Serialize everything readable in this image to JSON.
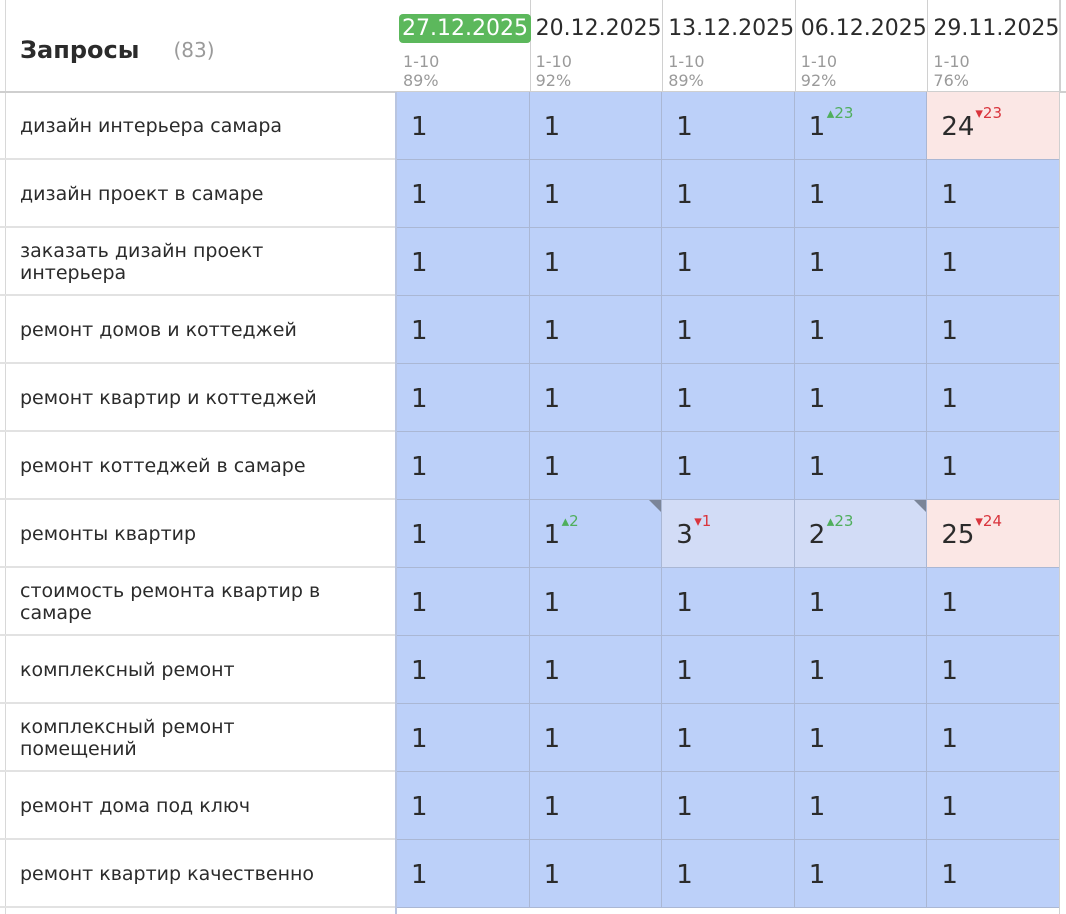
{
  "header": {
    "title": "Запросы",
    "count": "(83)"
  },
  "columns": [
    {
      "date": "27.12.2025",
      "range": "1-10",
      "percent": "89%",
      "active": true
    },
    {
      "date": "20.12.2025",
      "range": "1-10",
      "percent": "92%",
      "active": false
    },
    {
      "date": "13.12.2025",
      "range": "1-10",
      "percent": "89%",
      "active": false
    },
    {
      "date": "06.12.2025",
      "range": "1-10",
      "percent": "92%",
      "active": false
    },
    {
      "date": "29.11.2025",
      "range": "1-10",
      "percent": "76%",
      "active": false
    }
  ],
  "rows": [
    {
      "query": "дизайн интерьера самара",
      "cells": [
        {
          "v": "1"
        },
        {
          "v": "1"
        },
        {
          "v": "1"
        },
        {
          "v": "1",
          "delta": "▴23",
          "dir": "up"
        },
        {
          "v": "24",
          "delta": "▾23",
          "dir": "down",
          "style": "pink"
        }
      ]
    },
    {
      "query": "дизайн проект в самаре",
      "cells": [
        {
          "v": "1"
        },
        {
          "v": "1"
        },
        {
          "v": "1"
        },
        {
          "v": "1"
        },
        {
          "v": "1"
        }
      ]
    },
    {
      "query": "заказать дизайн проект интерьера",
      "cells": [
        {
          "v": "1"
        },
        {
          "v": "1"
        },
        {
          "v": "1"
        },
        {
          "v": "1"
        },
        {
          "v": "1"
        }
      ]
    },
    {
      "query": "ремонт домов и коттеджей",
      "cells": [
        {
          "v": "1"
        },
        {
          "v": "1"
        },
        {
          "v": "1"
        },
        {
          "v": "1"
        },
        {
          "v": "1"
        }
      ]
    },
    {
      "query": "ремонт квартир и коттеджей",
      "cells": [
        {
          "v": "1"
        },
        {
          "v": "1"
        },
        {
          "v": "1"
        },
        {
          "v": "1"
        },
        {
          "v": "1"
        }
      ]
    },
    {
      "query": "ремонт коттеджей в самаре",
      "cells": [
        {
          "v": "1"
        },
        {
          "v": "1"
        },
        {
          "v": "1"
        },
        {
          "v": "1"
        },
        {
          "v": "1"
        }
      ]
    },
    {
      "query": "ремонты квартир",
      "cells": [
        {
          "v": "1"
        },
        {
          "v": "1",
          "delta": "▴2",
          "dir": "up",
          "corner": true
        },
        {
          "v": "3",
          "delta": "▾1",
          "dir": "down",
          "style": "light"
        },
        {
          "v": "2",
          "delta": "▴23",
          "dir": "up",
          "style": "light",
          "corner": true
        },
        {
          "v": "25",
          "delta": "▾24",
          "dir": "down",
          "style": "pink"
        }
      ]
    },
    {
      "query": "стоимость ремонта квартир в самаре",
      "cells": [
        {
          "v": "1"
        },
        {
          "v": "1"
        },
        {
          "v": "1"
        },
        {
          "v": "1"
        },
        {
          "v": "1"
        }
      ]
    },
    {
      "query": "комплексный ремонт",
      "cells": [
        {
          "v": "1"
        },
        {
          "v": "1"
        },
        {
          "v": "1"
        },
        {
          "v": "1"
        },
        {
          "v": "1"
        }
      ]
    },
    {
      "query": "комплексный ремонт помещений",
      "cells": [
        {
          "v": "1"
        },
        {
          "v": "1"
        },
        {
          "v": "1"
        },
        {
          "v": "1"
        },
        {
          "v": "1"
        }
      ]
    },
    {
      "query": "ремонт дома под ключ",
      "cells": [
        {
          "v": "1"
        },
        {
          "v": "1"
        },
        {
          "v": "1"
        },
        {
          "v": "1"
        },
        {
          "v": "1"
        }
      ]
    },
    {
      "query": "ремонт квартир качественно",
      "cells": [
        {
          "v": "1"
        },
        {
          "v": "1"
        },
        {
          "v": "1"
        },
        {
          "v": "1"
        },
        {
          "v": "1"
        }
      ]
    }
  ]
}
